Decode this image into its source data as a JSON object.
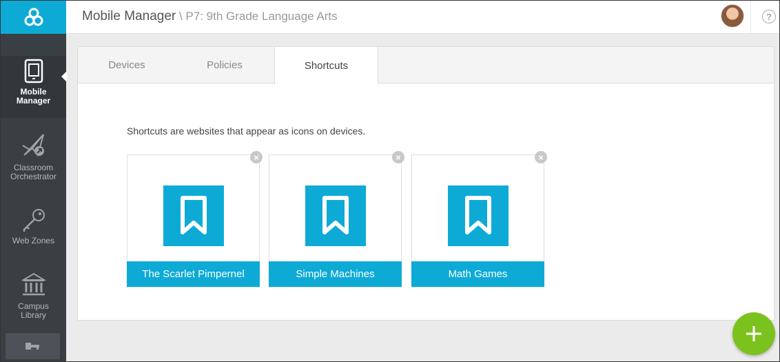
{
  "header": {
    "app_title": "Mobile Manager",
    "separator": " \\ ",
    "class_name": "P7: 9th Grade Language Arts",
    "help_symbol": "?"
  },
  "sidebar": {
    "items": [
      {
        "label_line1": "Mobile",
        "label_line2": "Manager",
        "icon": "tablet-icon",
        "active": true
      },
      {
        "label_line1": "Classroom",
        "label_line2": "Orchestrator",
        "icon": "paper-plane-icon",
        "active": false
      },
      {
        "label_line1": "Web Zones",
        "label_line2": "",
        "icon": "key-icon",
        "active": false
      },
      {
        "label_line1": "Campus",
        "label_line2": "Library",
        "icon": "library-icon",
        "active": false
      }
    ]
  },
  "tabs": [
    {
      "label": "Devices",
      "active": false
    },
    {
      "label": "Policies",
      "active": false
    },
    {
      "label": "Shortcuts",
      "active": true
    }
  ],
  "content": {
    "intro": "Shortcuts are websites that appear as icons on devices."
  },
  "shortcuts": [
    {
      "name": "The Scarlet Pimpernel",
      "icon": "bookmark-icon"
    },
    {
      "name": "Simple Machines",
      "icon": "bookmark-icon"
    },
    {
      "name": "Math Games",
      "icon": "bookmark-icon"
    }
  ],
  "colors": {
    "accent": "#0eaad6",
    "sidebar": "#3a3f44",
    "fab": "#7cc21e"
  }
}
